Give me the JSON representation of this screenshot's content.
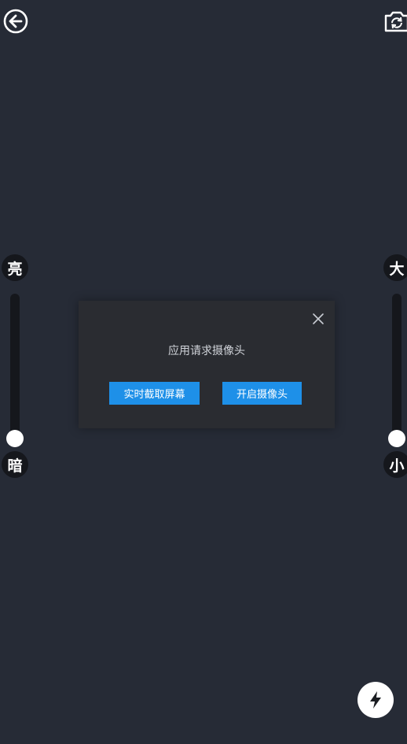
{
  "brightness": {
    "high_label": "亮",
    "low_label": "暗",
    "level": 0.0
  },
  "zoom": {
    "high_label": "大",
    "low_label": "小",
    "level": 0.0
  },
  "dialog": {
    "message": "应用请求摄像头",
    "screen_capture_label": "实时截取屏幕",
    "open_camera_label": "开启摄像头"
  },
  "icons": {
    "back": "back-arrow-icon",
    "camera_switch": "camera-switch-icon",
    "close": "close-icon",
    "flash": "flash-icon"
  },
  "colors": {
    "background": "#262b36",
    "accent": "#1e90e8",
    "dialog_bg": "#2a2c31"
  }
}
